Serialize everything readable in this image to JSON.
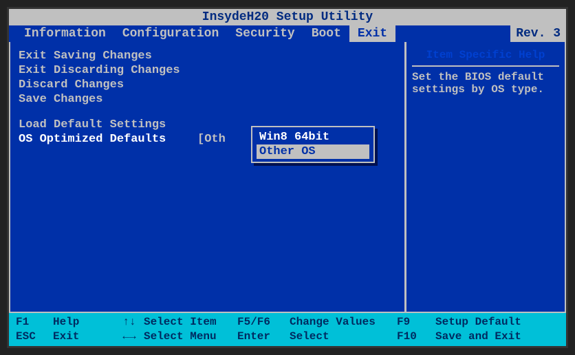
{
  "title": "InsydeH20 Setup Utility",
  "revision": "Rev. 3",
  "tabs": {
    "info": "Information",
    "config": "Configuration",
    "security": "Security",
    "boot": "Boot",
    "exit": "Exit"
  },
  "menu": {
    "exit_save": "Exit Saving Changes",
    "exit_discard": "Exit Discarding Changes",
    "discard": "Discard Changes",
    "save": "Save Changes",
    "load_defaults": "Load Default Settings",
    "os_optimized_label": "OS Optimized Defaults",
    "os_optimized_value": "[Oth"
  },
  "popup": {
    "option1": "Win8 64bit",
    "option2": "Other OS"
  },
  "help": {
    "title": "Item Specific Help",
    "body": "Set the BIOS default settings by OS type."
  },
  "footer": {
    "f1": "F1",
    "help": "Help",
    "updown": "↑↓",
    "select_item": "Select Item",
    "f5f6": "F5/F6",
    "change_values": "Change Values",
    "f9": "F9",
    "setup_default": "Setup Default",
    "esc": "ESC",
    "exit": "Exit",
    "leftright": "←→",
    "select_menu": "Select Menu",
    "enter": "Enter",
    "select": "Select",
    "f10": "F10",
    "save_exit": "Save and Exit"
  }
}
